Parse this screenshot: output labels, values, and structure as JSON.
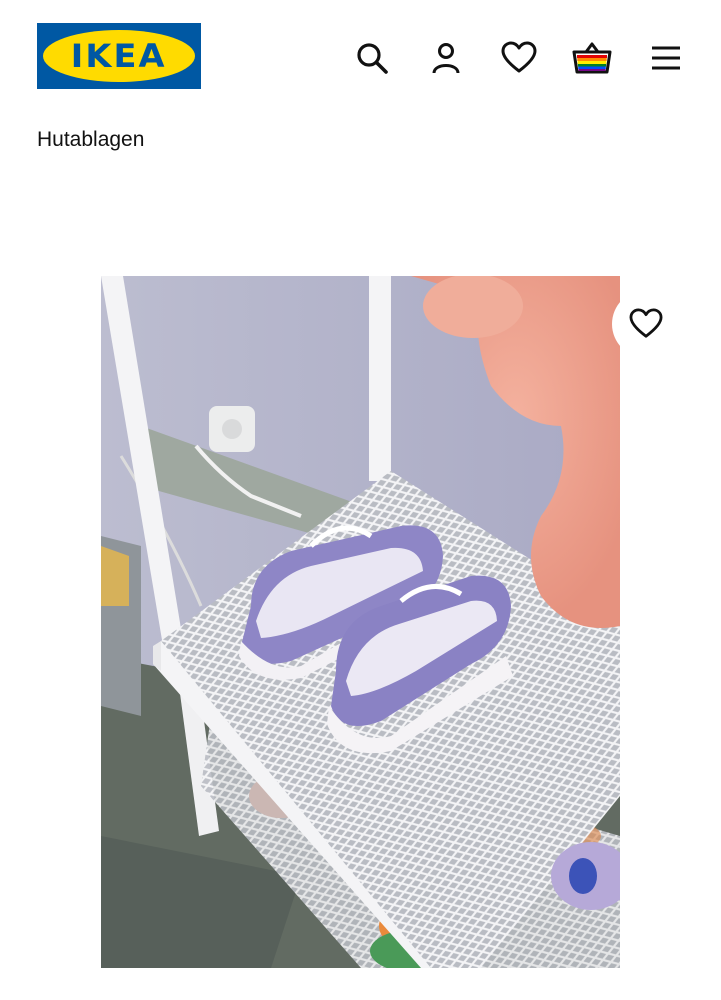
{
  "header": {
    "logo_text": "IKEA",
    "icons": [
      "search-icon",
      "profile-icon",
      "heart-icon",
      "basket-icon",
      "menu-icon"
    ]
  },
  "breadcrumb": {
    "label": "Hutablagen"
  },
  "product_image": {
    "favorite_icon": "heart-outline-icon"
  },
  "colors": {
    "brand_blue": "#0058a3",
    "brand_yellow": "#ffdb00",
    "text": "#111111"
  }
}
